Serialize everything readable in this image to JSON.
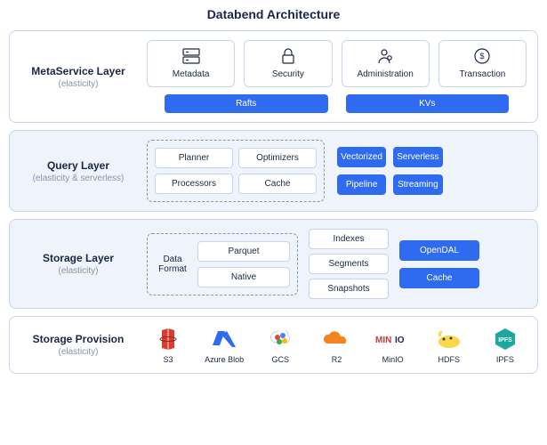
{
  "title": "Databend Architecture",
  "meta": {
    "title": "MetaService Layer",
    "sub": "(elasticity)",
    "cards": [
      "Metadata",
      "Security",
      "Administration",
      "Transaction"
    ],
    "sublabels": [
      "Rafts",
      "KVs"
    ]
  },
  "query": {
    "title": "Query Layer",
    "sub": "(elasticity & serverless)",
    "chips": [
      "Planner",
      "Optimizers",
      "Processors",
      "Cache"
    ],
    "bchips": [
      "Vectorized",
      "Serverless",
      "Pipeline",
      "Streaming"
    ]
  },
  "storage": {
    "title": "Storage Layer",
    "sub": "(elasticity)",
    "df_label": "Data Format",
    "df": [
      "Parquet",
      "Native"
    ],
    "col1": [
      "Indexes",
      "Segments",
      "Snapshots"
    ],
    "col2": [
      "OpenDAL",
      "Cache"
    ]
  },
  "provision": {
    "title": "Storage Provision",
    "sub": "(elasticity)",
    "items": [
      "S3",
      "Azure Blob",
      "GCS",
      "R2",
      "MinIO",
      "HDFS",
      "IPFS"
    ]
  }
}
